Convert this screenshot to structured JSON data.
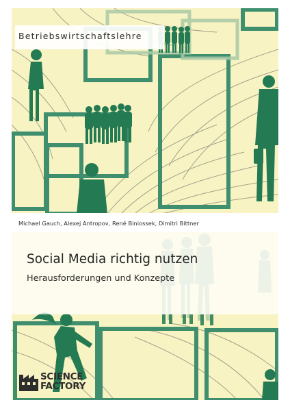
{
  "cover": {
    "category": "Betriebswirtschaftslehre",
    "authors": "Michael Gauch, Alexej Antropov,  René Biniossek, Dimitri Bittner",
    "title": "Social Media richtig nutzen",
    "subtitle": "Herausforderungen und Konzepte",
    "publisher": {
      "line1": "SCIENCE",
      "line2": "FACTORY",
      "icon": "science-factory-logo-icon"
    }
  },
  "colors": {
    "background": "#f7f3c2",
    "frame_green": "#3f8f6f",
    "silhouette_green": "#247a52",
    "line_gray": "#8a8a7a"
  }
}
